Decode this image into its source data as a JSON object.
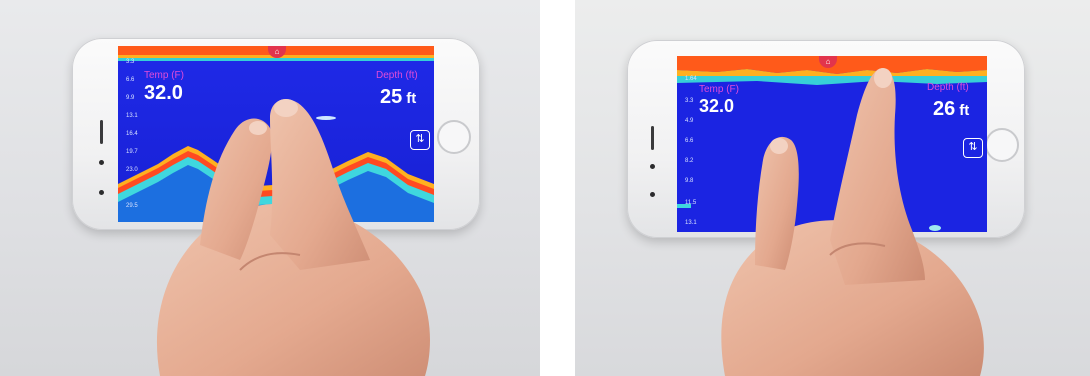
{
  "photos": [
    {
      "temp_label": "Temp (F)",
      "temp_value": "32.0",
      "depth_label": "Depth (ft)",
      "depth_value": "25",
      "depth_unit": "ft",
      "depth_ticks": [
        "3.3",
        "6.6",
        "9.9",
        "13.1",
        "16.4",
        "19.7",
        "23.0",
        "29.5"
      ]
    },
    {
      "temp_label": "Temp (F)",
      "temp_value": "32.0",
      "depth_label": "Depth (ft)",
      "depth_value": "26",
      "depth_unit": "ft",
      "depth_ticks": [
        "1.64",
        "3.3",
        "4.9",
        "6.6",
        "8.2",
        "9.8",
        "11.5",
        "13.1"
      ]
    }
  ],
  "colors": {
    "water": "#1a22e0",
    "label": "#e04bd8",
    "surface": "#ff5a1a",
    "bottom_return": "#ffb020",
    "badge": "#e2344c"
  },
  "icons": [
    "wifi-icon",
    "settings-sliders-icon",
    "home-button"
  ]
}
